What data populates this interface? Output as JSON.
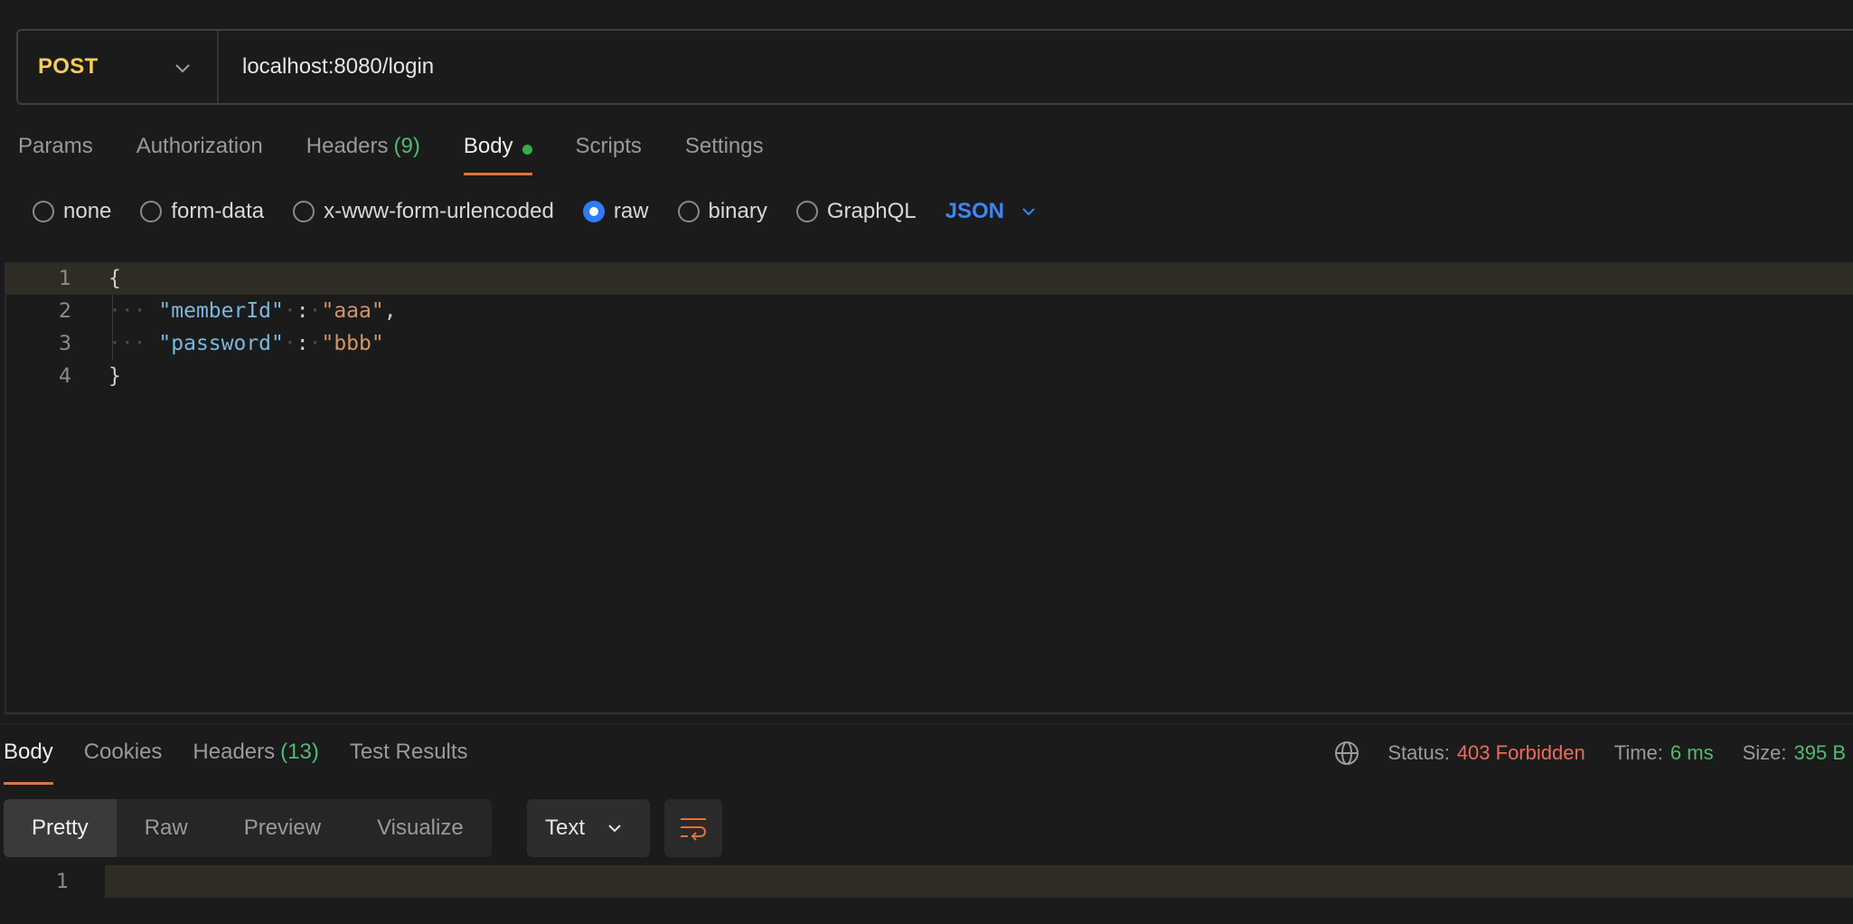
{
  "request": {
    "method": "POST",
    "url": "localhost:8080/login"
  },
  "request_tabs": [
    {
      "label": "Params"
    },
    {
      "label": "Authorization"
    },
    {
      "label": "Headers",
      "count": "(9)"
    },
    {
      "label": "Body"
    },
    {
      "label": "Scripts"
    },
    {
      "label": "Settings"
    }
  ],
  "body_types": [
    "none",
    "form-data",
    "x-www-form-urlencoded",
    "raw",
    "binary",
    "GraphQL"
  ],
  "body_format": "JSON",
  "editor": {
    "line_numbers": [
      "1",
      "2",
      "3",
      "4"
    ],
    "open_brace": "{",
    "close_brace": "}",
    "key1": "\"memberId\"",
    "val1": "\"aaa\"",
    "key2": "\"password\"",
    "val2": "\"bbb\""
  },
  "response_tabs": [
    {
      "label": "Body"
    },
    {
      "label": "Cookies"
    },
    {
      "label": "Headers",
      "count": "(13)"
    },
    {
      "label": "Test Results"
    }
  ],
  "status": {
    "status_label": "Status:",
    "status_value": "403 Forbidden",
    "time_label": "Time:",
    "time_value": "6 ms",
    "size_label": "Size:",
    "size_value": "395 B"
  },
  "view_modes": [
    "Pretty",
    "Raw",
    "Preview",
    "Visualize"
  ],
  "response_format": "Text",
  "response_line_number": "1",
  "colors": {
    "method": "#f6cd56",
    "accent": "#e8703a",
    "link_blue": "#3d86f5",
    "success_green": "#4fbd6e",
    "error_red": "#ef6b5b"
  }
}
